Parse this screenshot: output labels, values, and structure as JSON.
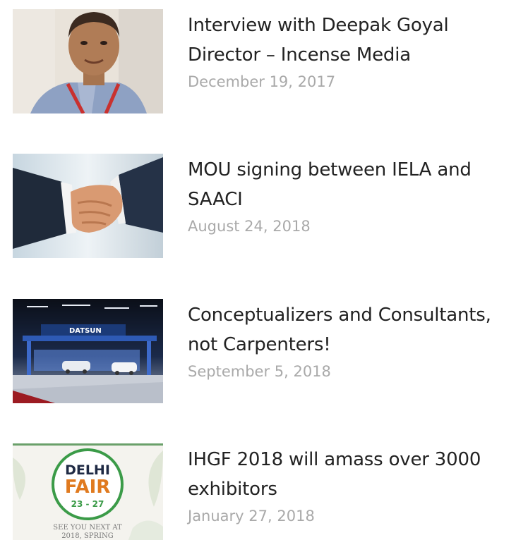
{
  "posts": [
    {
      "title": "Interview with Deepak Goyal Director – Incense Media",
      "date": "December 19, 2017",
      "thumbnail_icon": "portrait-photo"
    },
    {
      "title": "MOU signing between IELA and SAACI",
      "date": "August 24, 2018",
      "thumbnail_icon": "handshake-photo"
    },
    {
      "title": "Conceptualizers and Consultants, not Carpenters!",
      "date": "September 5, 2018",
      "thumbnail_icon": "exhibition-hall-photo",
      "thumbnail_sign": "DATSUN"
    },
    {
      "title": "IHGF 2018 will amass over 3000 exhibitors",
      "date": "January 27, 2018",
      "thumbnail_icon": "delhi-fair-logo",
      "logo": {
        "line1": "DELHI",
        "line2": "FAIR",
        "line3": "23 - 27",
        "tagline1": "SEE YOU NEXT AT",
        "tagline2": "2018, SPRING"
      }
    }
  ]
}
